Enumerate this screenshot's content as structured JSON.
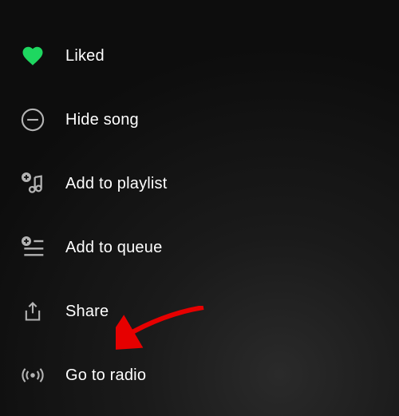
{
  "menu": {
    "items": [
      {
        "label": "Liked"
      },
      {
        "label": "Hide song"
      },
      {
        "label": "Add to playlist"
      },
      {
        "label": "Add to queue"
      },
      {
        "label": "Share"
      },
      {
        "label": "Go to radio"
      }
    ]
  },
  "colors": {
    "accent": "#1ed760",
    "icon": "#b3b3b3",
    "text": "#ffffff",
    "annotation": "#e60000"
  }
}
